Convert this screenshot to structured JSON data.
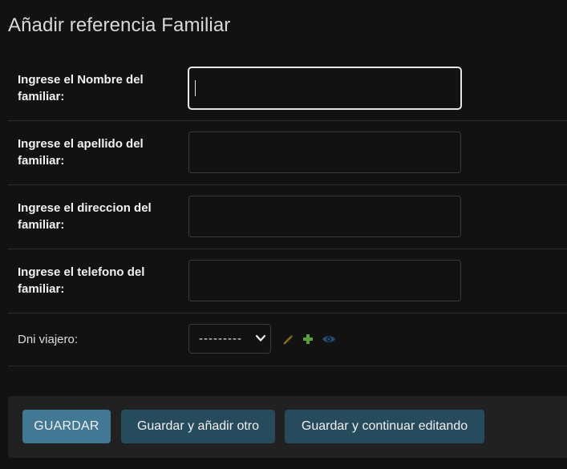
{
  "page": {
    "title": "Añadir referencia Familiar"
  },
  "fields": [
    {
      "label": "Ingrese el Nombre del familiar:",
      "value": "",
      "placeholder": ""
    },
    {
      "label": "Ingrese el apellido del familiar:",
      "value": "",
      "placeholder": ""
    },
    {
      "label": "Ingrese el direccion del familiar:",
      "value": "",
      "placeholder": ""
    },
    {
      "label": "Ingrese el telefono del familiar:",
      "value": "",
      "placeholder": ""
    }
  ],
  "dni": {
    "label": "Dni viajero:",
    "selected": "---------",
    "icons": [
      "pencil-icon",
      "plus-icon",
      "eye-icon"
    ]
  },
  "buttons": {
    "save": "GUARDAR",
    "save_add_another": "Guardar y añadir otro",
    "save_continue": "Guardar y continuar editando"
  },
  "colors": {
    "background": "#121212",
    "primary_button": "#417893",
    "secondary_button": "#264b5d",
    "edit_icon": "#7d6a1a",
    "add_icon": "#5aa02c",
    "view_icon": "#1f4f7a"
  }
}
